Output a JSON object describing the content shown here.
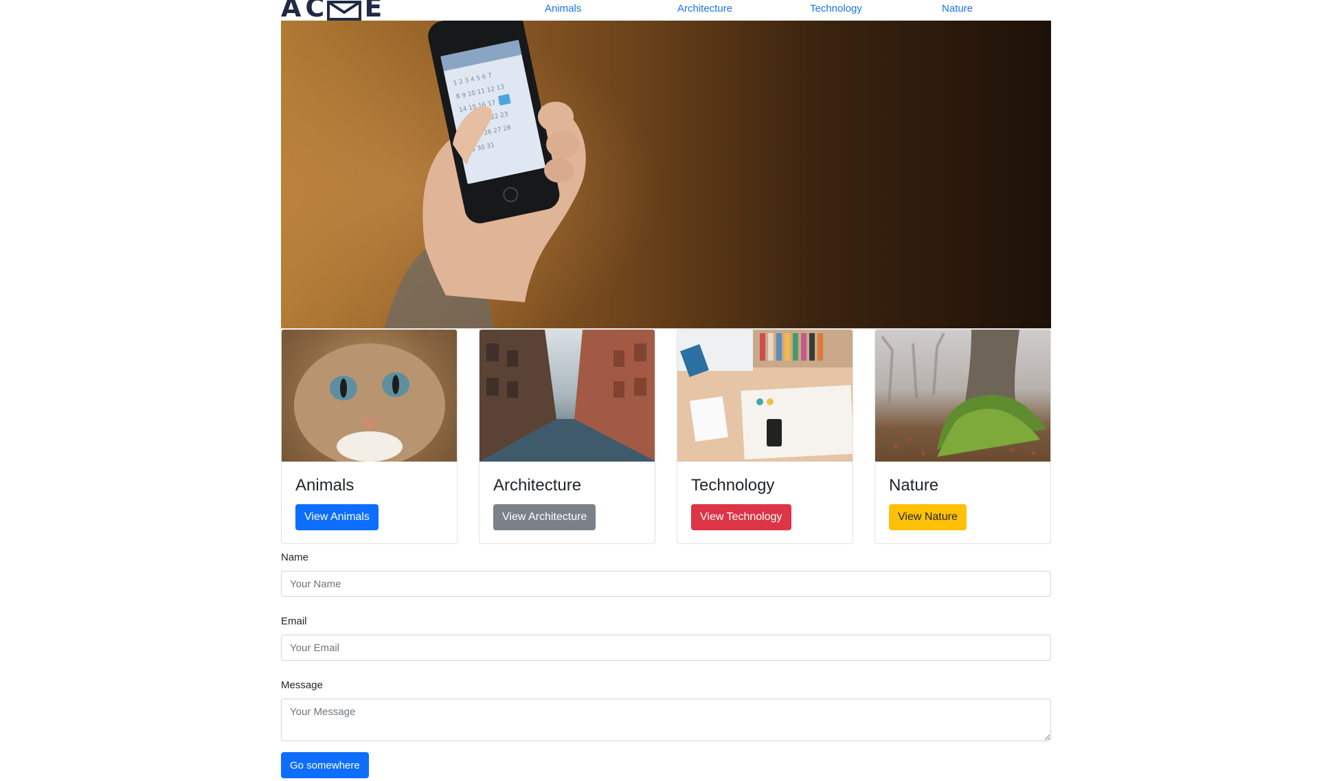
{
  "header": {
    "logo_letters": [
      "A",
      "C",
      "E"
    ],
    "logo_icon": "envelope-icon",
    "nav": [
      "Animals",
      "Architecture",
      "Technology",
      "Nature"
    ]
  },
  "hero": {
    "image": "hand-holding-phone-calendar-photo"
  },
  "cards": [
    {
      "title": "Animals",
      "button": "View Animals",
      "button_color": "#0d6efd",
      "image": "cat-photo"
    },
    {
      "title": "Architecture",
      "button": "View Architecture",
      "button_color": "#7a8189",
      "image": "city-street-photo"
    },
    {
      "title": "Technology",
      "button": "View Technology",
      "button_color": "#dc3545",
      "image": "desk-tech-photo"
    },
    {
      "title": "Nature",
      "button": "View Nature",
      "button_color": "#ffc107",
      "image": "mossy-tree-photo"
    }
  ],
  "form": {
    "name_label": "Name",
    "name_placeholder": "Your Name",
    "email_label": "Email",
    "email_placeholder": "Your Email",
    "message_label": "Message",
    "message_placeholder": "Your Message",
    "submit": "Go somewhere"
  }
}
